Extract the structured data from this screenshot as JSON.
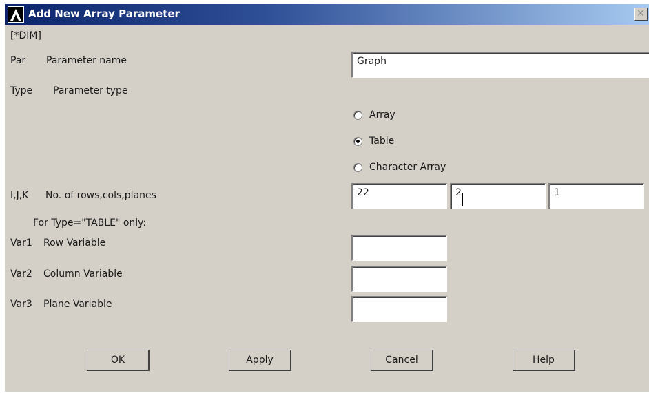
{
  "window": {
    "title": "Add New Array Parameter",
    "close_glyph": "✕"
  },
  "command": "[*DIM]",
  "par": {
    "code": "Par",
    "label": "Parameter name",
    "value": "Graph"
  },
  "type": {
    "code": "Type",
    "label": "Parameter type",
    "options": [
      {
        "label": "Array",
        "selected": false
      },
      {
        "label": "Table",
        "selected": true
      },
      {
        "label": "Character Array",
        "selected": false
      }
    ]
  },
  "ijk": {
    "code": "I,J,K",
    "label": "No. of rows,cols,planes",
    "rows": "22",
    "cols": "2",
    "planes": "1"
  },
  "table_note": "For Type=\"TABLE\" only:",
  "var1": {
    "code": "Var1",
    "label": "Row Variable",
    "value": ""
  },
  "var2": {
    "code": "Var2",
    "label": "Column Variable",
    "value": ""
  },
  "var3": {
    "code": "Var3",
    "label": "Plane Variable",
    "value": ""
  },
  "buttons": {
    "ok": "OK",
    "apply": "Apply",
    "cancel": "Cancel",
    "help": "Help"
  },
  "colors": {
    "face": "#d4d0c8",
    "title_start": "#0a246a",
    "title_end": "#a6caf0"
  }
}
